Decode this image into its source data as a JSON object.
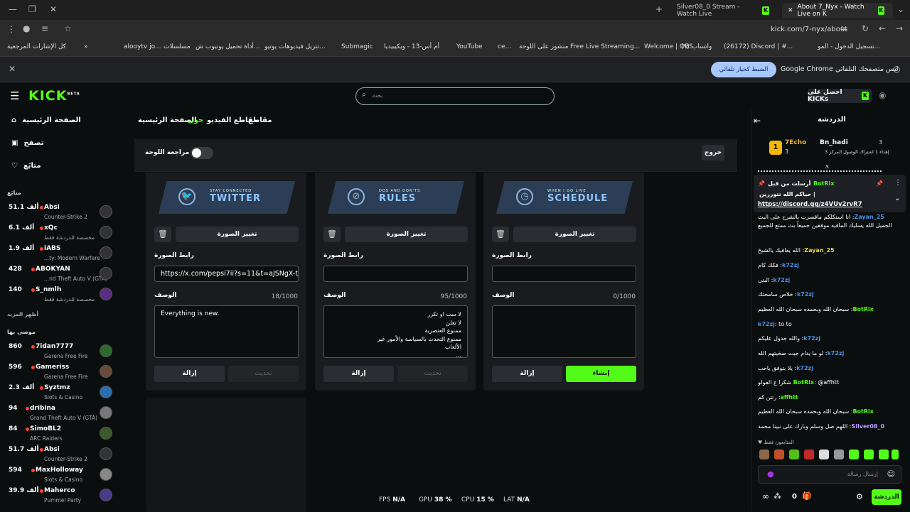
{
  "browser": {
    "tabs": [
      {
        "label": "Silver08_0 Stream - Watch Live"
      },
      {
        "label": "About 7_Nyx - Watch Live on K"
      }
    ],
    "url": "kick.com/7-nyx/about",
    "bookmarks": [
      "كل الإشارات المرجعية",
      "alooytv jo...",
      "مسلسلات",
      "أداة تحميل يوتيوب ش...",
      "تنزيل فيديوهات يوتيو...",
      "Submagic",
      "أم أس-13 - ويكيبيديا",
      "YouTube",
      "ce...",
      "منشور على اللوحة",
      "Free Live Streaming...",
      "Welcome | OBS",
      "(٩) واتساب",
      "(26172) Discord | #...",
      "تسجيل الدخول - المو..."
    ],
    "infobar": {
      "text": "Google Chrome ليس متصفحك التلقائي.",
      "button": "الضبط كخيار تلقائي"
    }
  },
  "header": {
    "logo": "KICK",
    "logo_beta": "BETA",
    "search_placeholder": "بحث",
    "get_kicks": "احصل على KICKs"
  },
  "sidebar": {
    "nav": [
      "الصفحة الرئيسية",
      "تصفح",
      "متابَع"
    ],
    "following_title": "متابَع",
    "following": [
      {
        "viewers": "51.1 ألف",
        "name": "Absi",
        "category": "Counter-Strike 2"
      },
      {
        "viewers": "6.1 ألف",
        "name": "xQc",
        "category": "مخصصة للدردشة فقط"
      },
      {
        "viewers": "1.9 ألف",
        "name": "iABS",
        "category": "...ty: Modern Warfare"
      },
      {
        "viewers": "428",
        "name": "ABOKYAN",
        "category": "...nd Theft Auto V (GTA)"
      },
      {
        "viewers": "140",
        "name": "S_nmlh",
        "category": "مخصصة للدردشة فقط"
      }
    ],
    "show_more": "أظهر المزيد",
    "recommended_title": "موصى بها",
    "recommended": [
      {
        "viewers": "860",
        "name": "7idan7777",
        "category": "Garena Free Fire"
      },
      {
        "viewers": "596",
        "name": "Gameriss",
        "category": "Garena Free Fire"
      },
      {
        "viewers": "2.3 ألف",
        "name": "Syztmz",
        "category": "Slots & Casino"
      },
      {
        "viewers": "94",
        "name": "dribina",
        "category": "Grand Theft Auto V (GTA)"
      },
      {
        "viewers": "84",
        "name": "SimoBL2",
        "category": "ARC Raiders"
      },
      {
        "viewers": "51.7 ألف",
        "name": "Absi",
        "category": "Counter-Strike 2"
      },
      {
        "viewers": "594",
        "name": "MaxHolloway",
        "category": "Slots & Casino"
      },
      {
        "viewers": "39.9 ألف",
        "name": "Maherco",
        "category": "Pummel Party"
      }
    ]
  },
  "channel_nav": {
    "clips": "مقاطع",
    "videos": "مقاطع الفيديو",
    "about": "حول",
    "home": "الصفحة الرئيسية"
  },
  "editor": {
    "review_label": "مراجعة اللوحة",
    "exit": "خروج"
  },
  "panels": [
    {
      "banner_small": "WHEN I GO LIVE",
      "banner_title": "SCHEDULE",
      "icon": "clock-icon",
      "change_image": "تغيير الصورة",
      "link_label": "رابط الصورة",
      "link_value": "",
      "desc_label": "الوصف",
      "count": "0/1000",
      "description": "",
      "remove": "إزالة",
      "update": "إنشاء",
      "update_active": true
    },
    {
      "banner_small": "DOS AND DON'TS",
      "banner_title": "RULES",
      "icon": "ban-icon",
      "change_image": "تغيير الصورة",
      "link_label": "رابط الصورة",
      "link_value": "",
      "desc_label": "الوصف",
      "count": "95/1000",
      "description": "لا سب او تكرر\nلا تعلن\nممنوع العنصرية\nممنوع التحدث بالسياسة والأمور غير الألعاب\n...",
      "remove": "إزالة",
      "update": "تحديث",
      "update_active": false
    },
    {
      "banner_small": "STAY CONNECTED",
      "banner_title": "TWITTER",
      "icon": "twitter-icon",
      "change_image": "تغيير الصورة",
      "link_label": "رابط الصورة",
      "link_value": "https://x.com/pepsi7ii?s=11&t=aJSNgX-tXI",
      "desc_label": "الوصف",
      "count": "18/1000",
      "description": "Everything is new.",
      "remove": "إزالة",
      "update": "تحديث",
      "update_active": false
    }
  ],
  "perf": {
    "fps_label": "FPS",
    "fps": "N/A",
    "gpu_label": "GPU",
    "gpu": "38 %",
    "cpu_label": "CPU",
    "cpu": "15 %",
    "lat_label": "LAT",
    "lat": "N/A"
  },
  "chat": {
    "title": "الدردشة",
    "top": [
      {
        "rank": "1",
        "name": "7Echo",
        "count": "3"
      },
      {
        "name": "Bn_hadi",
        "count": "3"
      }
    ],
    "top_note": "إهداء 1 اشتراك الوصول المركز 3",
    "pinned": {
      "by": "BotRix",
      "sent_label": "أرسلت من قبل",
      "text": "حياكم الله تتوررين |",
      "link": "https://discord.gg/z4VUv2rvR7"
    },
    "messages": [
      {
        "user": "Zayan_25",
        "text": "انا استكلكم ماقسرت بالشرح على البث الجميل الله يسليك المافيه موفقين جميعاً بث ممتع للجميع"
      },
      {
        "user": "Zayan_25",
        "text": "الله يعافيك يالشيخ"
      },
      {
        "user": "k72zj",
        "text": "فكك كام"
      },
      {
        "user": "k72zj",
        "text": "البتي"
      },
      {
        "user": "k72zj",
        "text": "خلاص سامحتك"
      },
      {
        "user": "BotRix",
        "text": "سبحان الله وبحمده سبحان الله العظيم"
      },
      {
        "user": "k72zj",
        "text": "to to"
      },
      {
        "user": "k72zj",
        "text": "والله جدول عليكم"
      },
      {
        "user": "k72zj",
        "text": "لو ما يدام جيت صخيتهم الله"
      },
      {
        "user": "k72zj",
        "text": "يلا بتوفق ياحب"
      },
      {
        "user": "BotRix",
        "text": "@affhtt شكرا ع الفولو"
      },
      {
        "user": "affhtt",
        "text": "رتتن كم"
      },
      {
        "user": "BotRix",
        "text": "سبحان الله وبحمده سبحان الله العظيم"
      },
      {
        "user": "Silver08_0",
        "text": "اللهم صل وسلم وبارك على نبينا محمد"
      }
    ],
    "followers_only": "المتابعون فقط",
    "input_placeholder": "إرسال رسالة",
    "send": "الدردشة",
    "kicks_count": "0"
  }
}
